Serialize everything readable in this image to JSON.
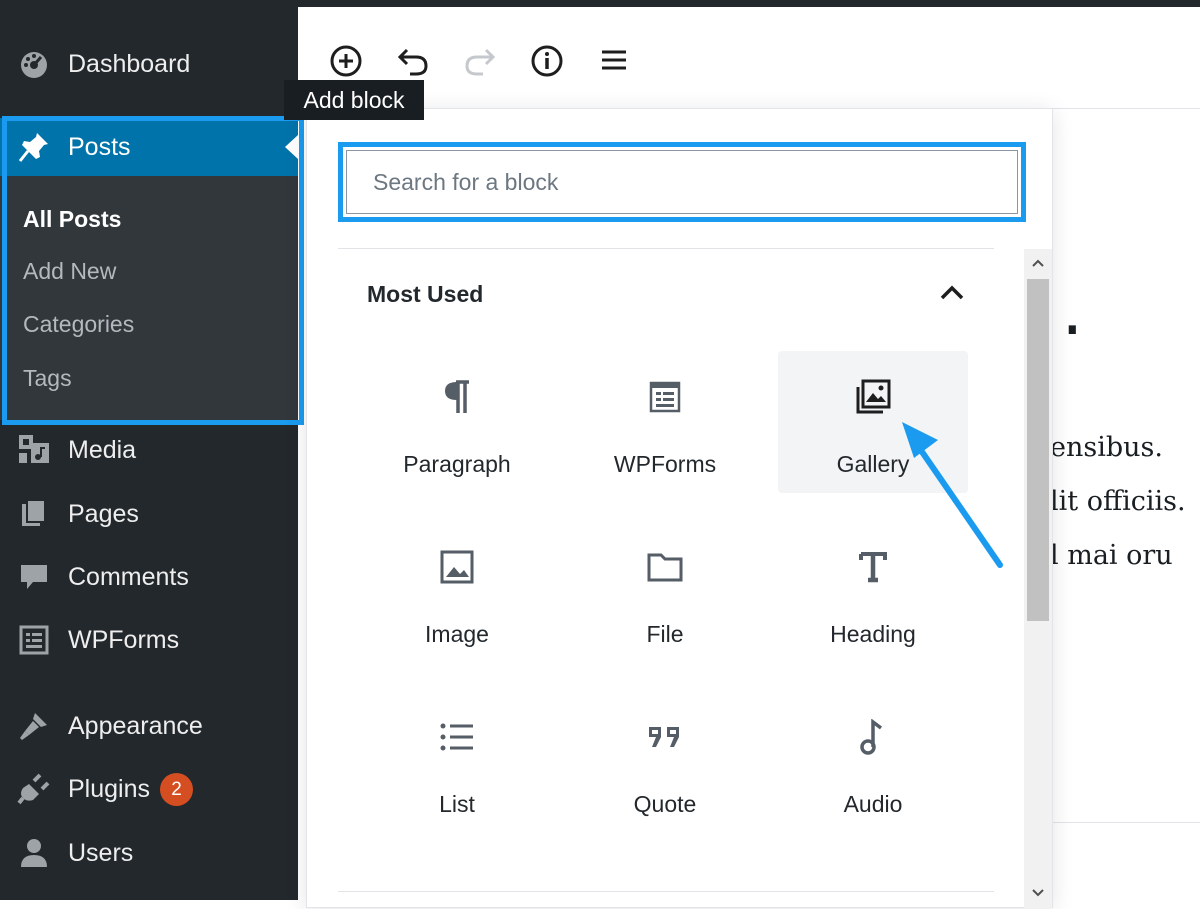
{
  "sidebar": {
    "items": [
      {
        "label": "Dashboard",
        "icon": "dashboard-icon"
      },
      {
        "label": "Posts",
        "icon": "pushpin-icon"
      },
      {
        "label": "Media",
        "icon": "media-icon"
      },
      {
        "label": "Pages",
        "icon": "pages-icon"
      },
      {
        "label": "Comments",
        "icon": "comment-icon"
      },
      {
        "label": "WPForms",
        "icon": "wpforms-icon"
      },
      {
        "label": "Appearance",
        "icon": "paintbrush-icon"
      },
      {
        "label": "Plugins",
        "icon": "plugin-icon",
        "badge": "2"
      },
      {
        "label": "Users",
        "icon": "user-icon"
      }
    ],
    "posts_submenu": [
      "All Posts",
      "Add New",
      "Categories",
      "Tags"
    ]
  },
  "toolbar": {
    "tooltip": "Add block",
    "buttons": [
      "add-block-icon",
      "undo-icon",
      "redo-icon",
      "info-icon",
      "block-navigation-icon"
    ]
  },
  "inserter": {
    "search_placeholder": "Search for a block",
    "section_title": "Most Used",
    "blocks": [
      {
        "label": "Paragraph",
        "icon": "paragraph-icon"
      },
      {
        "label": "WPForms",
        "icon": "wpforms-block-icon"
      },
      {
        "label": "Gallery",
        "icon": "gallery-icon"
      },
      {
        "label": "Image",
        "icon": "image-icon"
      },
      {
        "label": "File",
        "icon": "folder-icon"
      },
      {
        "label": "Heading",
        "icon": "heading-icon"
      },
      {
        "label": "List",
        "icon": "list-icon"
      },
      {
        "label": "Quote",
        "icon": "quote-icon"
      },
      {
        "label": "Audio",
        "icon": "audio-icon"
      }
    ]
  },
  "editor": {
    "title_fragment": "t.",
    "body_lines": [
      "ensibus.",
      "lit officiis.",
      "l mai oru"
    ]
  },
  "colors": {
    "sidebar_bg": "#23282d",
    "active_menu": "#0073aa",
    "highlight": "#1a9bf0",
    "badge": "#d54e21"
  }
}
